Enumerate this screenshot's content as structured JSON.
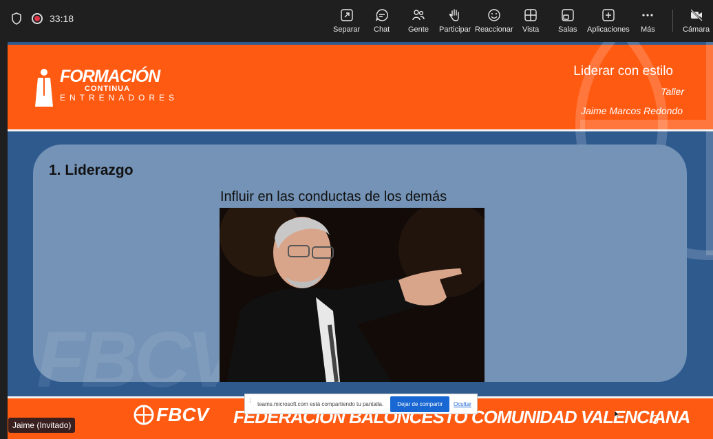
{
  "toolbar": {
    "timer": "33:18",
    "buttons": [
      {
        "label": "Separar",
        "icon": "pop-out-icon"
      },
      {
        "label": "Chat",
        "icon": "chat-icon"
      },
      {
        "label": "Gente",
        "icon": "people-icon"
      },
      {
        "label": "Participar",
        "icon": "raise-hand-icon"
      },
      {
        "label": "Reaccionar",
        "icon": "react-icon"
      },
      {
        "label": "Vista",
        "icon": "view-icon"
      },
      {
        "label": "Salas",
        "icon": "rooms-icon"
      },
      {
        "label": "Aplicaciones",
        "icon": "apps-icon"
      },
      {
        "label": "Más",
        "icon": "more-icon"
      },
      {
        "label": "Cámara",
        "icon": "camera-off-icon"
      }
    ]
  },
  "slide": {
    "logo": {
      "line1": "FORMACIÓN",
      "line2": "CONTINUA",
      "line3": "ENTRENADORES"
    },
    "title": "Liderar con estilo",
    "subtitle": "Taller",
    "author": "Jaime Marcos Redondo",
    "section": "1.   Liderazgo",
    "caption": "Influir en las conductas de los demás",
    "watermark": "FBCV",
    "footer_logo": "FBCV",
    "footer_name": "FEDERACIÓN BALONCESTO COMUNIDAD VALENCIANA",
    "page_number": "3"
  },
  "share_bar": {
    "message": "teams.microsoft.com está compartiendo tu pantalla.",
    "stop_label": "Dejar de compartir",
    "hide_label": "Ocultar"
  },
  "participant": {
    "name": "Jaime (Invitado)"
  },
  "colors": {
    "accent": "#ff5a12",
    "slide_bg": "#2e5a8e",
    "panel": "#7493b6"
  }
}
